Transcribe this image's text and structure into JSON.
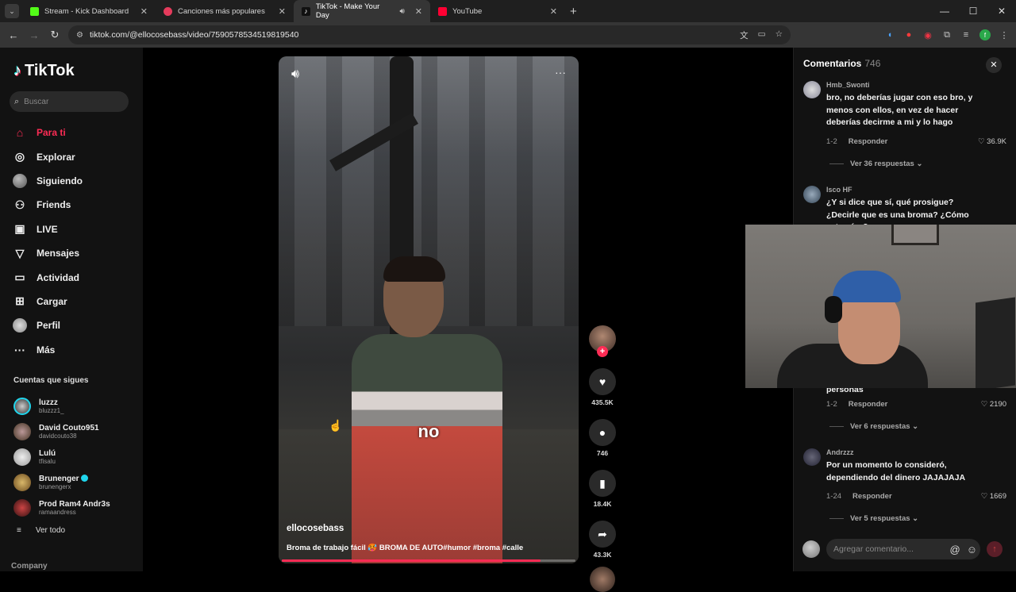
{
  "browser": {
    "tabs": [
      {
        "title": "Stream - Kick Dashboard",
        "color": "#53fc18",
        "active": false
      },
      {
        "title": "Canciones más populares",
        "color": "#e53b5c",
        "active": false
      },
      {
        "title": "TikTok - Make Your Day",
        "color": "#222222",
        "active": true
      },
      {
        "title": "YouTube",
        "color": "#ff0033",
        "active": false
      }
    ],
    "url": "tiktok.com/@ellocosebass/video/7590578534519819540"
  },
  "sidebar": {
    "brand": "TikTok",
    "search_placeholder": "Buscar",
    "nav": [
      {
        "label": "Para ti",
        "icon": "home-icon",
        "active": true
      },
      {
        "label": "Explorar",
        "icon": "compass-icon",
        "active": false
      },
      {
        "label": "Siguiendo",
        "icon": "avatar-icon",
        "active": false
      },
      {
        "label": "Friends",
        "icon": "friends-icon",
        "active": false
      },
      {
        "label": "LIVE",
        "icon": "live-icon",
        "active": false
      },
      {
        "label": "Mensajes",
        "icon": "send-icon",
        "active": false
      },
      {
        "label": "Actividad",
        "icon": "activity-icon",
        "active": false
      },
      {
        "label": "Cargar",
        "icon": "upload-icon",
        "active": false
      },
      {
        "label": "Perfil",
        "icon": "profile-icon",
        "active": false
      },
      {
        "label": "Más",
        "icon": "more-icon",
        "active": false
      }
    ],
    "following_title": "Cuentas que sigues",
    "following": [
      {
        "name": "luzzz",
        "handle": "bluzzz1_",
        "verified": false
      },
      {
        "name": "David Couto951",
        "handle": "davidcouto38",
        "verified": false
      },
      {
        "name": "Lulú",
        "handle": "tfisalu",
        "verified": false
      },
      {
        "name": "Brunenger",
        "handle": "brunengerx",
        "verified": true
      },
      {
        "name": "Prod Ram4 Andr3s",
        "handle": "ramaandress",
        "verified": false
      }
    ],
    "see_all": "Ver todo",
    "company": "Company"
  },
  "video": {
    "caption_word": "no",
    "username": "ellocosebass",
    "description": "Broma de trabajo fácil 🥵 BROMA DE AUTO#humor #broma #calle",
    "progress": 0.88
  },
  "actions": {
    "likes": "435.5K",
    "comments": "746",
    "saves": "18.4K",
    "shares": "43.3K"
  },
  "comments_panel": {
    "title": "Comentarios",
    "count": "746",
    "items": [
      {
        "user": "Hmb_Swonti",
        "text": "bro, no deberías jugar con eso bro, y menos con ellos, en vez de hacer deberías decirme a mi y lo hago",
        "date": "1-2",
        "reply": "Responder",
        "likes": "36.9K",
        "more": "Ver 36 respuestas"
      },
      {
        "user": "Isco HF",
        "text": "¿Y si dice que sí, qué prosigue? ¿Decirle que es una broma? ¿Cómo actuarías?",
        "date": "",
        "reply": "",
        "likes": "",
        "more": ""
      },
      {
        "user": "",
        "text": "personas",
        "date": "1-2",
        "reply": "Responder",
        "likes": "2190",
        "more": "Ver 6 respuestas"
      },
      {
        "user": "Andrzzz",
        "text": "Por un momento lo consideró, dependiendo del dinero JAJAJAJA",
        "date": "1-24",
        "reply": "Responder",
        "likes": "1669",
        "more": "Ver 5 respuestas"
      }
    ],
    "add_placeholder": "Agregar comentario..."
  }
}
